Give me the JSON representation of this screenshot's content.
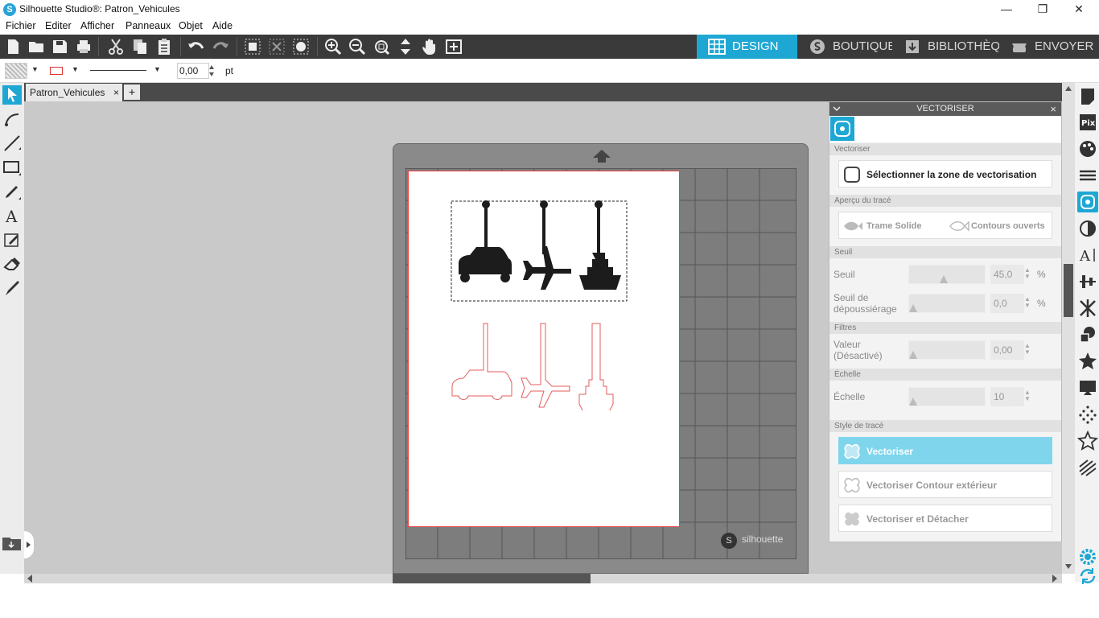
{
  "window": {
    "title": "Silhouette Studio®: Patron_Vehicules",
    "minimize": "—",
    "restore": "❐",
    "close": "✕",
    "app_icon": "S"
  },
  "menu": [
    "Fichier",
    "Editer",
    "Afficher",
    "Panneaux",
    "Objet",
    "Aide"
  ],
  "nav_tabs": [
    {
      "label": "DESIGN",
      "icon": "grid-icon",
      "active": true
    },
    {
      "label": "BOUTIQUE",
      "icon": "silhouette-s-icon",
      "active": false
    },
    {
      "label": "BIBLIOTHÈQUE",
      "icon": "library-download-icon",
      "active": false
    },
    {
      "label": "ENVOYER",
      "icon": "cutter-icon",
      "active": false
    }
  ],
  "propbar": {
    "stroke_width": "0,00",
    "unit": "pt",
    "arrow": "▼"
  },
  "tabs": {
    "document": "Patron_Vehicules",
    "close": "×",
    "add": "+"
  },
  "mat": {
    "brand": "silhouette"
  },
  "panel": {
    "title": "VECTORISER",
    "close": "×",
    "sections": {
      "vectoriser": "Vectoriser",
      "apercu": "Aperçu du tracé",
      "seuil": "Seuil",
      "filtres": "Filtres",
      "echelle": "Échelle",
      "style": "Style de tracé"
    },
    "select_area_button": "Sélectionner la zone de vectorisation",
    "preview": {
      "solid": "Trame Solide",
      "open": "Contours ouverts"
    },
    "threshold": {
      "label": "Seuil",
      "value": "45,0",
      "unit": "%",
      "level": 0.45
    },
    "despeckle": {
      "label_line1": "Seuil de",
      "label_line2": "dépoussiérage",
      "value": "0,0",
      "unit": "%"
    },
    "filter": {
      "label_line1": "Valeur",
      "label_line2": "(Désactivé)",
      "value": "0,00"
    },
    "scale": {
      "label": "Échelle",
      "value": "10"
    },
    "styles": [
      {
        "label": "Vectoriser",
        "active": true
      },
      {
        "label": "Vectoriser Contour extérieur",
        "active": false
      },
      {
        "label": "Vectoriser et Détacher",
        "active": false
      }
    ]
  }
}
